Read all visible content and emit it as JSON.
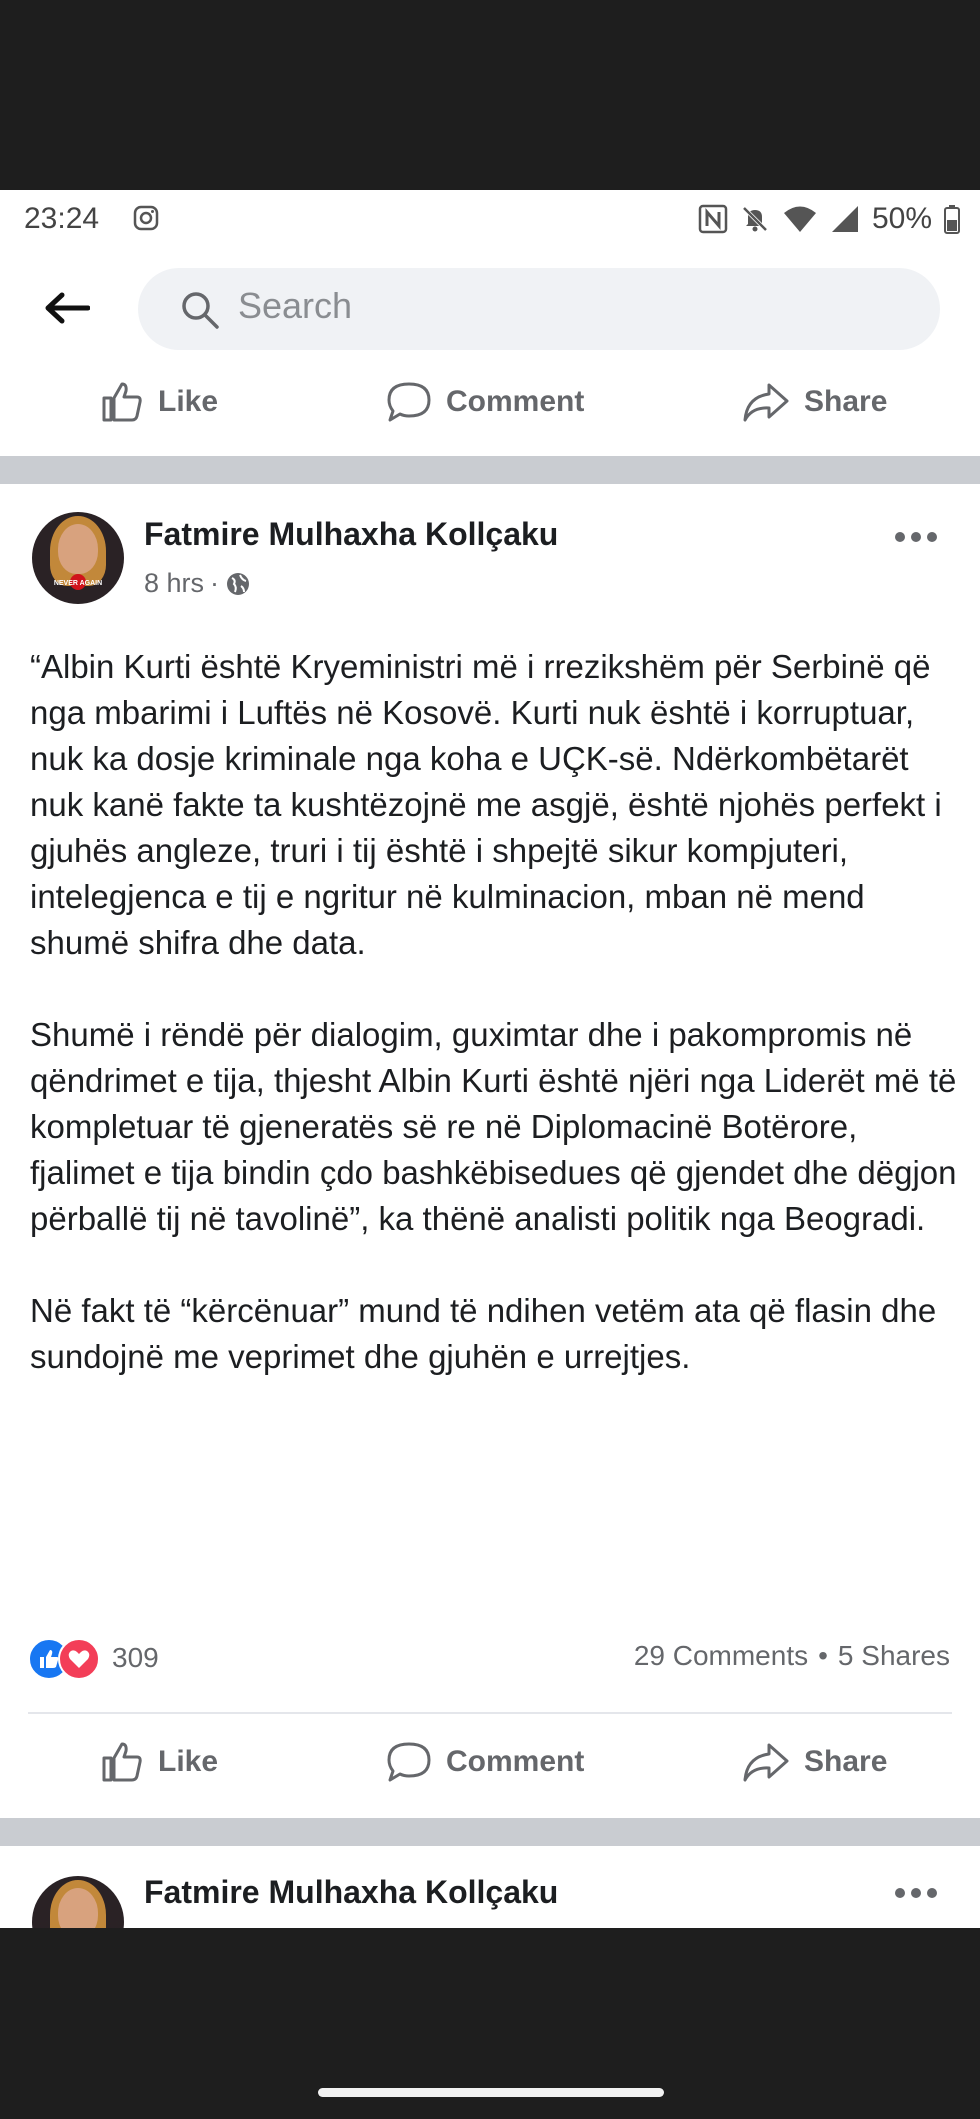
{
  "status_bar": {
    "time": "23:24",
    "battery": "50%",
    "icons": [
      "instagram-icon",
      "nfc-icon",
      "mute-icon",
      "wifi-icon",
      "signal-icon",
      "battery-icon"
    ]
  },
  "search": {
    "placeholder": "Search"
  },
  "actions": {
    "like": "Like",
    "comment": "Comment",
    "share": "Share"
  },
  "post": {
    "author": "Fatmire Mulhaxha Kollçaku",
    "time": "8 hrs",
    "avatar_caption": "NEVER AGAIN",
    "paragraphs": [
      "“Albin Kurti është Kryeministri më i rrezikshëm për Serbinë që nga mbarimi i Luftës në Kosovë. Kurti nuk është i korruptuar, nuk ka dosje kriminale nga koha e UÇK-së. Ndërkombëtarët nuk kanë fakte ta kushtëzojnë me asgjë, është njohës perfekt i gjuhës angleze, truri i tij është i shpejtë sikur kompjuteri, intelegjenca e tij e ngritur në kulminacion, mban në mend shumë shifra dhe data.",
      "Shumë i rëndë për dialogim, guximtar dhe i pakompromis në qëndrimet e tija, thjesht Albin Kurti është njëri nga Liderët më të kompletuar të gjeneratës së re në Diplomacinë Botërore, fjalimet e tija bindin çdo bashkëbisedues që gjendet dhe dëgjon përballë tij në tavolinë”, ka thënë analisti politik nga Beogradi.",
      "Në fakt të “kërcënuar” mund të ndihen vetëm ata që flasin dhe sundojnë me veprimet dhe gjuhën e urrejtjes."
    ],
    "reactions_count": "309",
    "comments": "29 Comments",
    "shares": "5 Shares",
    "separator_dot": "•"
  },
  "next_post": {
    "author": "Fatmire Mulhaxha Kollçaku"
  },
  "colors": {
    "text": "#1c1e21",
    "secondary": "#65676b",
    "like_blue": "#1877f2",
    "love_red": "#f33e58",
    "separator": "#c9ccd1"
  }
}
